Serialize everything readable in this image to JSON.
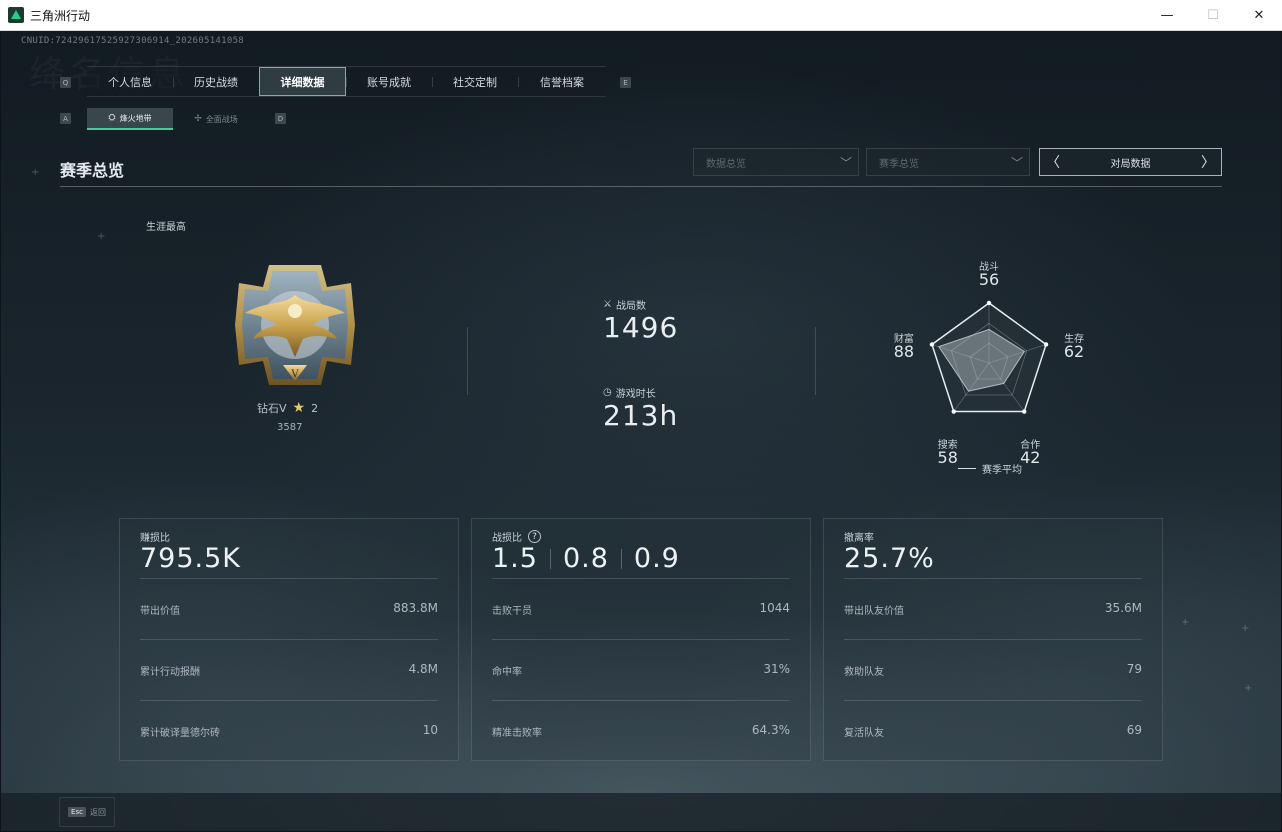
{
  "window": {
    "title": "三角洲行动",
    "controls": [
      "—",
      "☐",
      "✕"
    ]
  },
  "uid": "CNUID:7242961752592730691​4_202605141058",
  "watermark": "绛名信息",
  "main_tabs": {
    "left_key": "Q",
    "right_key": "E",
    "items": [
      {
        "label": "个人信息",
        "active": false
      },
      {
        "label": "历史战绩",
        "active": false
      },
      {
        "label": "详细数据",
        "active": true
      },
      {
        "label": "账号成就",
        "active": false
      },
      {
        "label": "社交定制",
        "active": false
      },
      {
        "label": "信誉档案",
        "active": false
      }
    ]
  },
  "sub_tabs": {
    "left_key": "A",
    "right_key": "D",
    "items": [
      {
        "label": "烽火地带",
        "icon": "⛭",
        "active": true
      },
      {
        "label": "全面战场",
        "icon": "✢",
        "active": false
      }
    ]
  },
  "section": {
    "title": "赛季总览"
  },
  "filters": {
    "data_overview": "数据总览",
    "season_overview": "赛季总览",
    "match_data": "对局数据"
  },
  "career": {
    "label": "生涯最高",
    "rank_name": "钻石V",
    "stars": "2",
    "score": "3587"
  },
  "stats": {
    "matches_label": "战局数",
    "matches_value": "1496",
    "playtime_label": "游戏时长",
    "playtime_value": "213h"
  },
  "radar": {
    "axes": [
      {
        "label": "战斗",
        "value": 56
      },
      {
        "label": "生存",
        "value": 62
      },
      {
        "label": "合作",
        "value": 42
      },
      {
        "label": "搜索",
        "value": 58
      },
      {
        "label": "财富",
        "value": 88
      }
    ],
    "legend": "赛季平均"
  },
  "cards": [
    {
      "title": "赚损比",
      "big": "795.5K",
      "rows": [
        {
          "label": "带出价值",
          "value": "883.8M"
        },
        {
          "label": "累计行动报酬",
          "value": "4.8M"
        },
        {
          "label": "累计破译量德尔砖",
          "value": "10"
        }
      ]
    },
    {
      "title": "战损比",
      "help": "?",
      "bigs": [
        "1.5",
        "0.8",
        "0.9"
      ],
      "rows": [
        {
          "label": "击败干员",
          "value": "1044"
        },
        {
          "label": "命中率",
          "value": "31%"
        },
        {
          "label": "精准击败率",
          "value": "64.3%"
        }
      ]
    },
    {
      "title": "撤离率",
      "big": "25.7%",
      "rows": [
        {
          "label": "带出队友价值",
          "value": "35.6M"
        },
        {
          "label": "救助队友",
          "value": "79"
        },
        {
          "label": "复活队友",
          "value": "69"
        }
      ]
    }
  ],
  "footer": {
    "key": "Esc",
    "label": "返回"
  }
}
